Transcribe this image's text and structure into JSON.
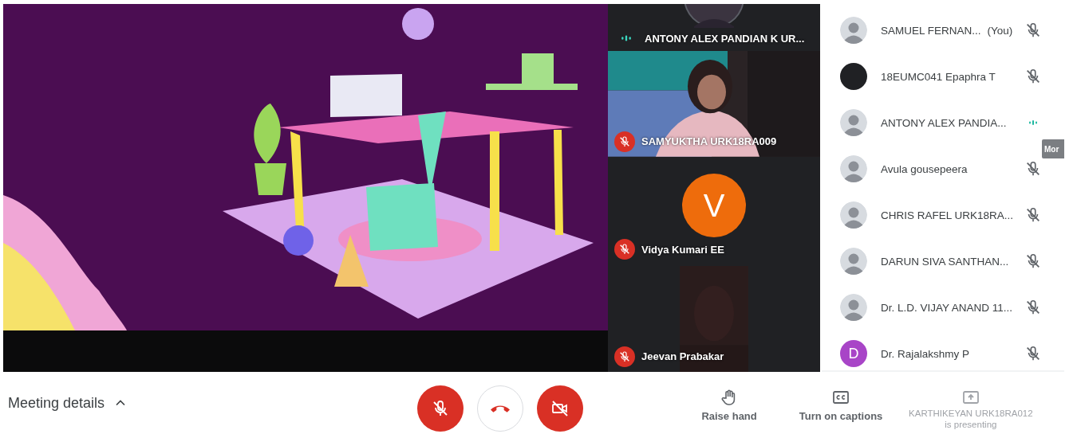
{
  "tiles": [
    {
      "kind": "video-top",
      "name": "ANTONY ALEX PANDIAN K UR...",
      "muted": false
    },
    {
      "kind": "video",
      "name": "SAMYUKTHA URK18RA009",
      "muted": true
    },
    {
      "kind": "initial",
      "initial": "V",
      "color": "#ee6c0c",
      "name": "Vidya Kumari EE",
      "muted": true
    },
    {
      "kind": "video-dark",
      "name": "Jeevan Prabakar",
      "muted": true
    }
  ],
  "participants": [
    {
      "name": "SAMUEL FERNAN...",
      "suffix": "(You)",
      "muted": true
    },
    {
      "kind": "blank",
      "color": "#202124",
      "name": "18EUMC041 Epaphra T",
      "muted": true
    },
    {
      "name": "ANTONY ALEX PANDIA...",
      "muted": false
    },
    {
      "name": "Avula gousepeera",
      "muted": true
    },
    {
      "name": "CHRIS RAFEL URK18RA...",
      "muted": true
    },
    {
      "name": "DARUN SIVA SANTHAN...",
      "muted": true
    },
    {
      "name": "Dr. L.D. VIJAY ANAND 11...",
      "muted": true
    },
    {
      "kind": "initial",
      "initial": "D",
      "color": "#a845c7",
      "name": "Dr. Rajalakshmy P",
      "muted": true
    }
  ],
  "tooltip": "Mor",
  "bottom_bar": {
    "meeting_details": "Meeting details",
    "controls": [
      {
        "kind": "mic",
        "on": false
      },
      {
        "kind": "hangup"
      },
      {
        "kind": "camera",
        "on": false
      }
    ],
    "actions": [
      {
        "kind": "hand",
        "label": "Raise hand"
      },
      {
        "kind": "captions",
        "label": "Turn on captions"
      }
    ],
    "presenting": {
      "name": "KARTHIKEYAN URK18RA012",
      "status": "is presenting"
    }
  }
}
